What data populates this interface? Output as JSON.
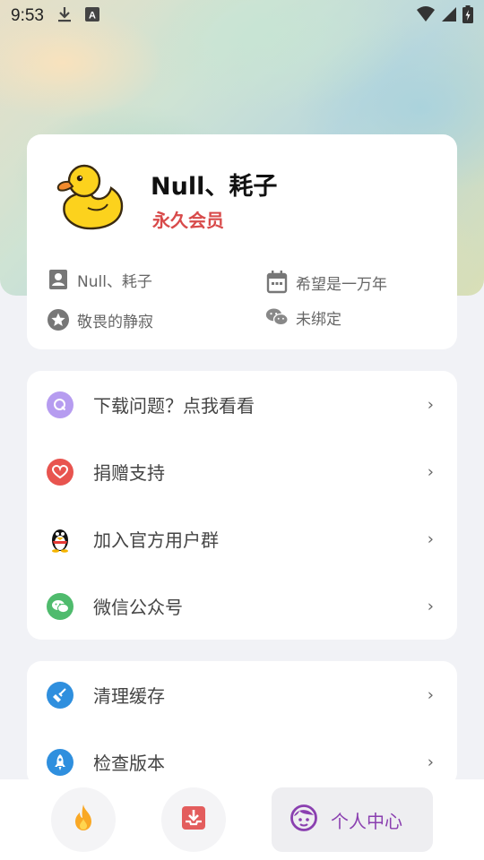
{
  "status_bar": {
    "time": "9:53",
    "icons": [
      "download-icon",
      "a-notification-icon",
      "wifi-icon",
      "signal-icon",
      "battery-charging-icon"
    ]
  },
  "profile": {
    "name": "Null、耗子",
    "membership": "永久会员",
    "avatar": "duck-avatar",
    "info": {
      "username": "Null、耗子",
      "slogan": "希望是一万年",
      "signature": "敬畏的静寂",
      "wechat": "未绑定"
    }
  },
  "menu": [
    {
      "label": "下载问题？点我看看",
      "icon": "q-icon",
      "color": "#b69cf0"
    },
    {
      "label": "捐赠支持",
      "icon": "heart-icon",
      "color": "#e8544f"
    },
    {
      "label": "加入官方用户群",
      "icon": "qq-penguin-icon",
      "color": "#222222"
    },
    {
      "label": "微信公众号",
      "icon": "wechat-icon",
      "color": "#4fbb6d"
    }
  ],
  "menu2": [
    {
      "label": "清理缓存",
      "icon": "broom-icon",
      "color": "#2f8fde"
    },
    {
      "label": "检查版本",
      "icon": "rocket-icon",
      "color": "#2f8fde"
    }
  ],
  "bottom_nav": {
    "hot_icon": "flame-icon",
    "download_icon": "inbox-download-icon",
    "profile_label": "个人中心",
    "profile_icon": "face-icon",
    "accent": "#8a3fb0"
  }
}
